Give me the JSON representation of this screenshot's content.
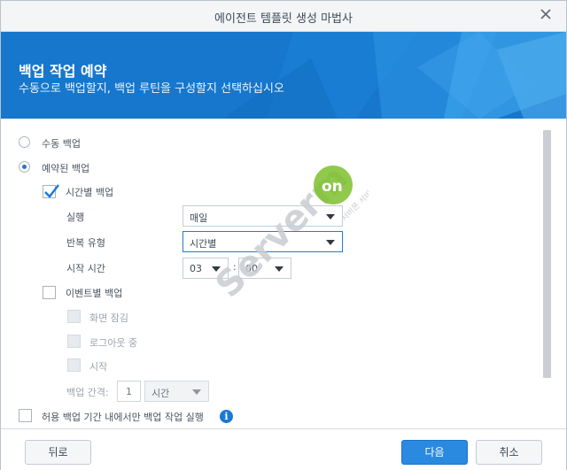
{
  "window": {
    "title": "에이전트 템플릿 생성 마법사"
  },
  "banner": {
    "heading": "백업 작업 예약",
    "subheading": "수동으로 백업할지, 백업 루틴을 구성할지 선택하십시오"
  },
  "options": {
    "manual_label": "수동 백업",
    "scheduled_label": "예약된 백업",
    "scheduled_selected": true,
    "hourly_label": "시간별 백업",
    "hourly_checked": true,
    "run_label": "실행",
    "run_value": "매일",
    "repeat_label": "반복 유형",
    "repeat_value": "시간별",
    "start_label": "시작 시간",
    "start_hour": "03",
    "start_sep": ":",
    "start_minute": "00",
    "event_label": "이벤트별 백업",
    "event_checked": false,
    "screen_lock_label": "화면 잠김",
    "logout_label": "로그아웃 중",
    "startup_label": "시작",
    "interval_label": "백업 간격:",
    "interval_value": "1",
    "interval_unit": "시간",
    "allowed_window_label": "허용 백업 기간 내에서만 백업 작업 실행",
    "info_icon_glyph": "i"
  },
  "footer": {
    "back_label": "뒤로",
    "next_label": "다음",
    "cancel_label": "취소"
  },
  "watermark": {
    "main": "Serverm",
    "brand": "on",
    "tagline": "서버몬 서비스"
  },
  "colors": {
    "accent": "#1a78d6",
    "banner": "#1677cc",
    "primary_button": "#2a8ae0",
    "watermark_green": "#7dbf2b"
  },
  "icons": {
    "close": "close-icon",
    "check": "check-icon",
    "info": "info-icon",
    "dropdown": "chevron-down-icon"
  }
}
